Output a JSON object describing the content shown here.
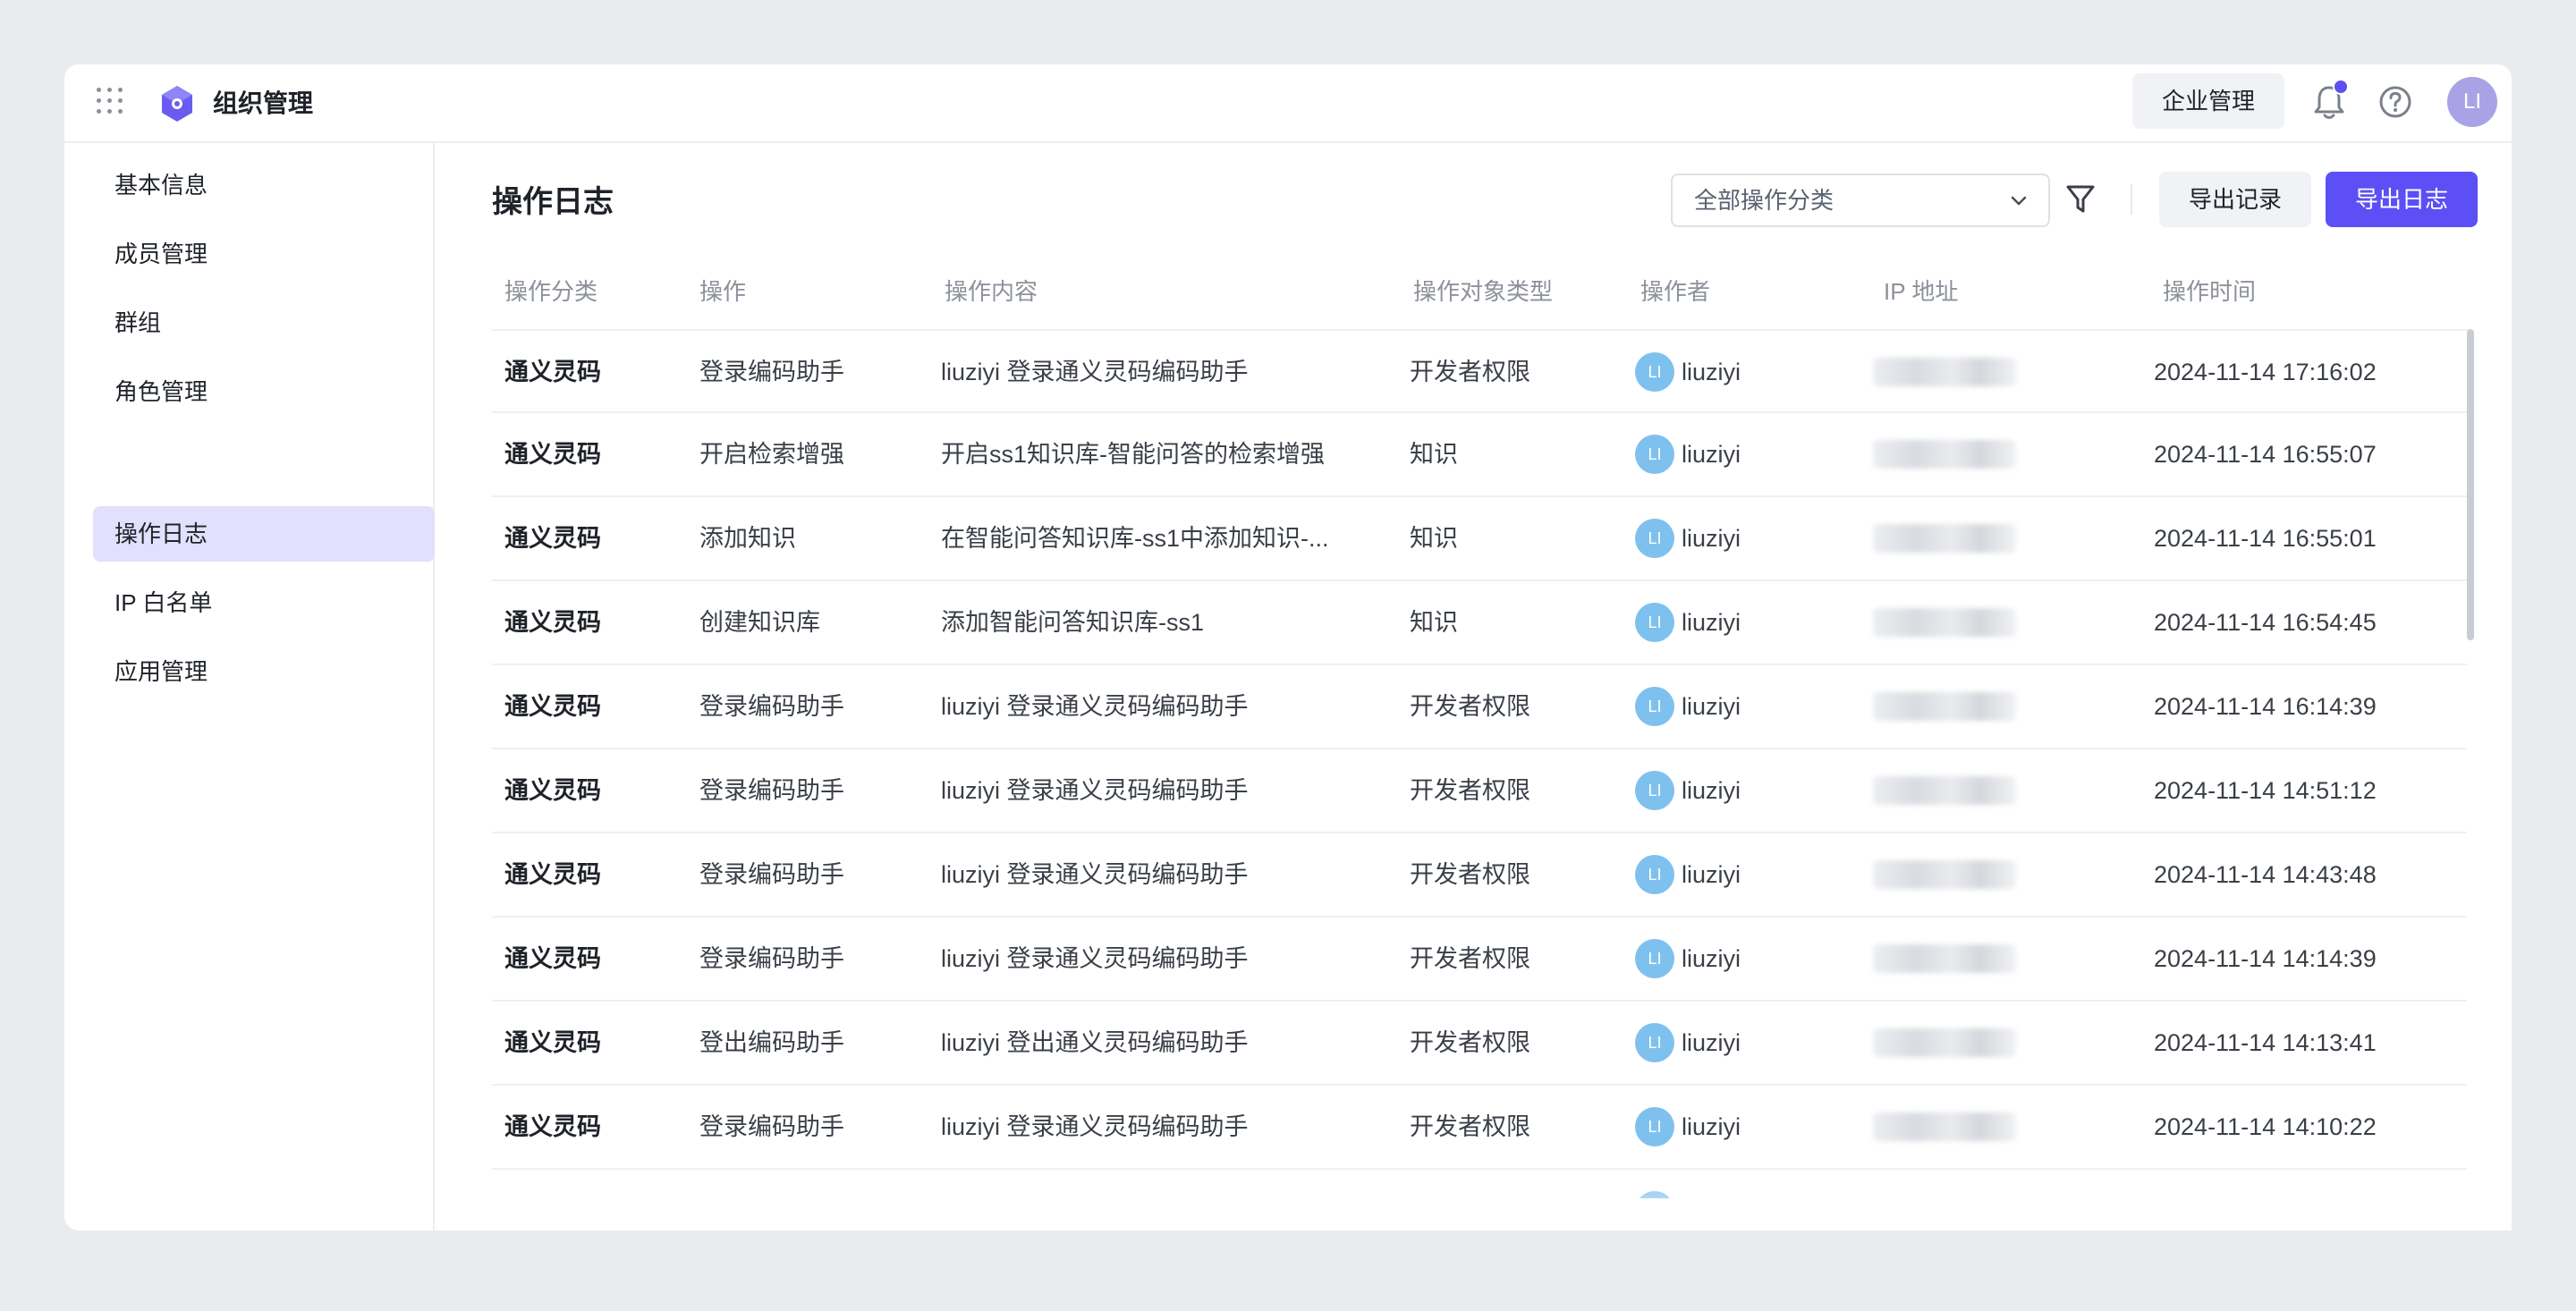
{
  "header": {
    "title": "组织管理",
    "enterprise_button": "企业管理",
    "avatar_initials": "LI",
    "icons": [
      "apps-grid-icon",
      "app-logo-icon",
      "bell-icon",
      "help-icon"
    ]
  },
  "sidebar": {
    "items": [
      {
        "label": "基本信息"
      },
      {
        "label": "成员管理"
      },
      {
        "label": "群组"
      },
      {
        "label": "角色管理"
      },
      {
        "label": "操作日志",
        "active": true
      },
      {
        "label": "IP 白名单"
      },
      {
        "label": "应用管理"
      }
    ]
  },
  "main": {
    "title": "操作日志",
    "filter_select": "全部操作分类",
    "export_records_button": "导出记录",
    "export_log_button": "导出日志"
  },
  "table": {
    "headers": [
      "操作分类",
      "操作",
      "操作内容",
      "操作对象类型",
      "操作者",
      "IP 地址",
      "操作时间"
    ],
    "rows": [
      {
        "category": "通义灵码",
        "action": "登录编码助手",
        "content": "liuziyi 登录通义灵码编码助手",
        "object_type": "开发者权限",
        "avatar": "LI",
        "operator": "liuziyi",
        "time": "2024-11-14 17:16:02"
      },
      {
        "category": "通义灵码",
        "action": "开启检索增强",
        "content": "开启ss1知识库-智能问答的检索增强",
        "object_type": "知识",
        "avatar": "LI",
        "operator": "liuziyi",
        "time": "2024-11-14 16:55:07"
      },
      {
        "category": "通义灵码",
        "action": "添加知识",
        "content": "在智能问答知识库-ss1中添加知识-...",
        "object_type": "知识",
        "avatar": "LI",
        "operator": "liuziyi",
        "time": "2024-11-14 16:55:01"
      },
      {
        "category": "通义灵码",
        "action": "创建知识库",
        "content": "添加智能问答知识库-ss1",
        "object_type": "知识",
        "avatar": "LI",
        "operator": "liuziyi",
        "time": "2024-11-14 16:54:45"
      },
      {
        "category": "通义灵码",
        "action": "登录编码助手",
        "content": "liuziyi 登录通义灵码编码助手",
        "object_type": "开发者权限",
        "avatar": "LI",
        "operator": "liuziyi",
        "time": "2024-11-14 16:14:39"
      },
      {
        "category": "通义灵码",
        "action": "登录编码助手",
        "content": "liuziyi 登录通义灵码编码助手",
        "object_type": "开发者权限",
        "avatar": "LI",
        "operator": "liuziyi",
        "time": "2024-11-14 14:51:12"
      },
      {
        "category": "通义灵码",
        "action": "登录编码助手",
        "content": "liuziyi 登录通义灵码编码助手",
        "object_type": "开发者权限",
        "avatar": "LI",
        "operator": "liuziyi",
        "time": "2024-11-14 14:43:48"
      },
      {
        "category": "通义灵码",
        "action": "登录编码助手",
        "content": "liuziyi 登录通义灵码编码助手",
        "object_type": "开发者权限",
        "avatar": "LI",
        "operator": "liuziyi",
        "time": "2024-11-14 14:14:39"
      },
      {
        "category": "通义灵码",
        "action": "登出编码助手",
        "content": "liuziyi 登出通义灵码编码助手",
        "object_type": "开发者权限",
        "avatar": "LI",
        "operator": "liuziyi",
        "time": "2024-11-14 14:13:41"
      },
      {
        "category": "通义灵码",
        "action": "登录编码助手",
        "content": "liuziyi 登录通义灵码编码助手",
        "object_type": "开发者权限",
        "avatar": "LI",
        "operator": "liuziyi",
        "time": "2024-11-14 14:10:22"
      }
    ]
  },
  "colors": {
    "accent": "#5b4ff5",
    "active_nav_bg": "#e2e0fc",
    "user_avatar": "#7fc1ee",
    "top_avatar": "#a9a3e6"
  }
}
